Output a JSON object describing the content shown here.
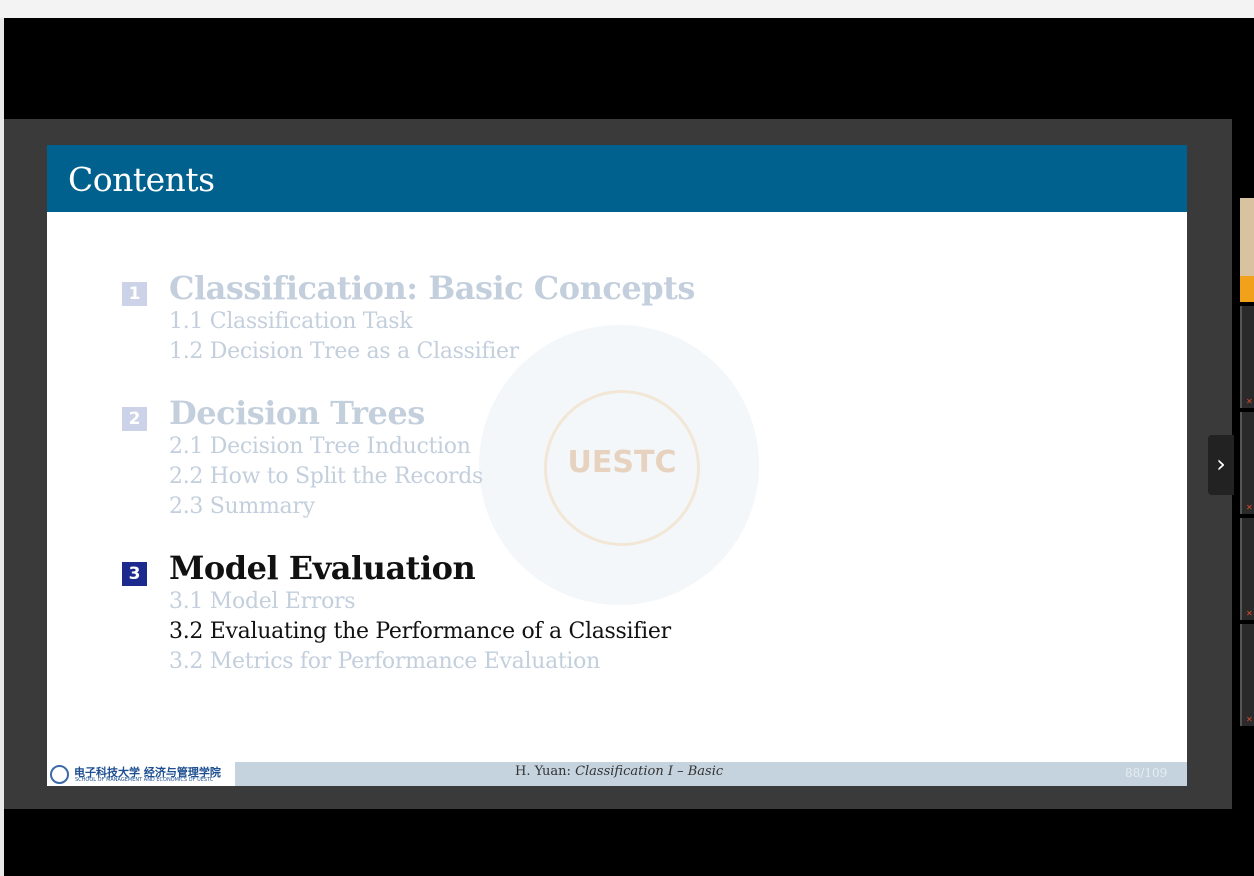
{
  "slide": {
    "title": "Contents",
    "watermark_text": "UESTC",
    "toc": [
      {
        "number": "1",
        "title": "Classification: Basic Concepts",
        "state": "faded",
        "subsections": [
          "1.1 Classification Task",
          "1.2 Decision Tree as a Classifier"
        ]
      },
      {
        "number": "2",
        "title": "Decision Trees",
        "state": "faded",
        "subsections": [
          "2.1 Decision Tree Induction",
          "2.2 How to Split the Records",
          "2.3 Summary"
        ]
      },
      {
        "number": "3",
        "title": "Model Evaluation",
        "state": "active",
        "subsections": [
          "3.1 Model Errors",
          "3.2 Evaluating the Performance of a Classifier",
          "3.2 Metrics for Performance Evaluation"
        ],
        "active_subsection_index": 1
      }
    ],
    "footer": {
      "logo_cn": "电子科技大学 经济与管理学院",
      "logo_en": "SCHOOL OF MANAGEMENT AND ECONOMICS OF UESTC",
      "author": "H. Yuan: ",
      "talk_title": "Classification I – Basic",
      "page": "88/109"
    }
  },
  "controls": {
    "next_icon": "chevron-right-icon",
    "next_glyph": "›"
  },
  "colors": {
    "header": "#00618e",
    "active_number": "#1b2a8c",
    "faded_text": "#c3cfdc"
  }
}
